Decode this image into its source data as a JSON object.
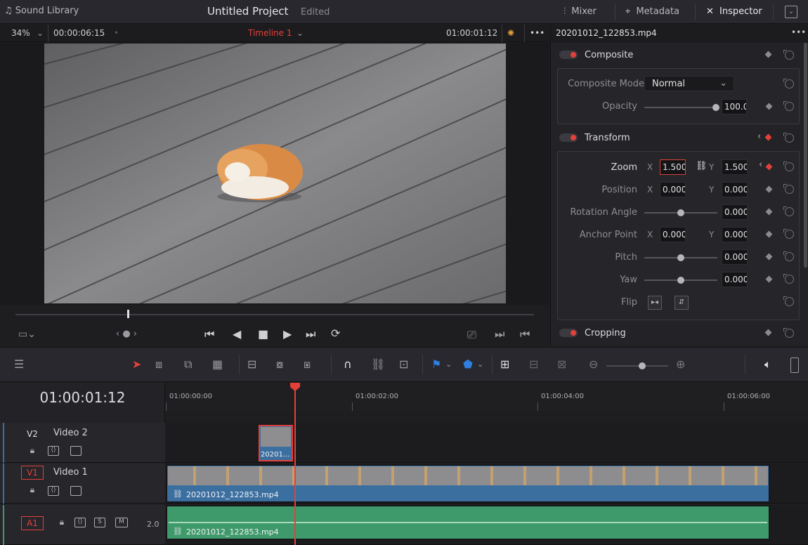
{
  "topbar": {
    "sound_library": "Sound Library",
    "project_title": "Untitled Project",
    "edited": "Edited",
    "mixer": "Mixer",
    "metadata": "Metadata",
    "inspector": "Inspector"
  },
  "viewer": {
    "zoom": "34%",
    "duration": "00:00:06:15",
    "timeline_name": "Timeline 1",
    "timecode": "01:00:01:12"
  },
  "inspector": {
    "clip_name": "20201012_122853.mp4",
    "composite": {
      "title": "Composite",
      "mode_label": "Composite Mode",
      "mode_value": "Normal",
      "opacity_label": "Opacity",
      "opacity_value": "100.00",
      "opacity_level": 1.0
    },
    "transform": {
      "title": "Transform",
      "zoom_label": "Zoom",
      "zoom_x": "1.500",
      "zoom_y": "1.500",
      "position_label": "Position",
      "position_x": "0.000",
      "position_y": "0.000",
      "rotation_label": "Rotation Angle",
      "rotation_value": "0.000",
      "anchor_label": "Anchor Point",
      "anchor_x": "0.000",
      "anchor_y": "0.000",
      "pitch_label": "Pitch",
      "pitch_value": "0.000",
      "yaw_label": "Yaw",
      "yaw_value": "0.000",
      "flip_label": "Flip",
      "x_letter": "X",
      "y_letter": "Y"
    },
    "cropping": {
      "title": "Cropping"
    }
  },
  "timeline": {
    "timecode": "01:00:01:12",
    "ruler": [
      "01:00:00:00",
      "01:00:02:00",
      "01:00:04:00",
      "01:00:06:00"
    ],
    "tracks": {
      "v2": {
        "id": "V2",
        "name": "Video 2",
        "clip": "20201..."
      },
      "v1": {
        "id": "V1",
        "name": "Video 1",
        "clip": "20201012_122853.mp4"
      },
      "a1": {
        "id": "A1",
        "level": "2.0",
        "clip": "20201012_122853.mp4",
        "s": "S",
        "m": "M"
      }
    }
  },
  "colors": {
    "accent_red": "#e4403a",
    "video_clip": "#3b6fa0",
    "audio_clip": "#3f9a6b"
  }
}
